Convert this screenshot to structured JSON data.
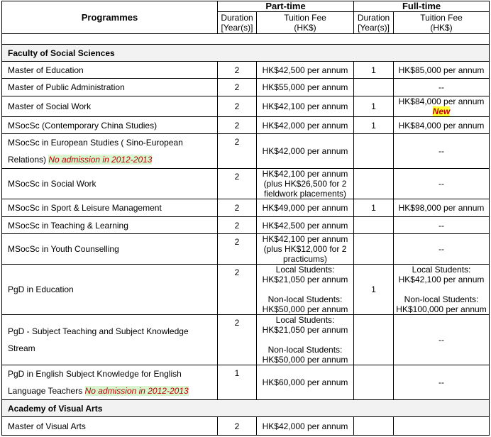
{
  "header": {
    "programmes": "Programmes",
    "part_time": "Part-time",
    "full_time": "Full-time",
    "duration_line1": "Duration",
    "duration_line2": "[Year(s)]",
    "fee_line1": "Tuition Fee",
    "fee_line2": "(HK$)"
  },
  "sections": [
    {
      "title": "Faculty of Social Sciences",
      "rows": [
        {
          "name": "Master of Education",
          "pt_dur": "2",
          "pt_fee": [
            "HK$42,500 per annum"
          ],
          "ft_dur": "1",
          "ft_fee": [
            "HK$85,000 per annum"
          ]
        },
        {
          "name": "Master of Public Administration",
          "pt_dur": "2",
          "pt_fee": [
            "HK$55,000 per annum"
          ],
          "ft_dur": "",
          "ft_fee": [
            "--"
          ]
        },
        {
          "name": "Master of Social Work",
          "pt_dur": "2",
          "pt_fee": [
            "HK$42,100 per annum"
          ],
          "ft_dur": "1",
          "ft_fee": [
            "HK$84,000 per annum"
          ],
          "ft_badge": "New"
        },
        {
          "name": "MSocSc (Contemporary China Studies)",
          "pt_dur": "2",
          "pt_fee": [
            "HK$42,000 per annum"
          ],
          "ft_dur": "1",
          "ft_fee": [
            "HK$84,000 per annum"
          ]
        },
        {
          "name": "MSocSc in European Studies ( Sino-European",
          "name2": "Relations)",
          "note": "No admission in 2012-2013",
          "pt_dur": "2",
          "pt_fee": [
            "HK$42,000 per annum"
          ],
          "ft_dur": "",
          "ft_fee": [
            "--"
          ]
        },
        {
          "name": "MSocSc in Social Work",
          "pt_dur": "2",
          "pt_fee": [
            "HK$42,100 per annum",
            "(plus HK$26,500 for 2",
            "fieldwork placements)"
          ],
          "ft_dur": "",
          "ft_fee": [
            "--"
          ]
        },
        {
          "name": "MSocSc in Sport & Leisure Management",
          "pt_dur": "2",
          "pt_fee": [
            "HK$49,000 per annum"
          ],
          "ft_dur": "1",
          "ft_fee": [
            "HK$98,000 per annum"
          ]
        },
        {
          "name": "MSocSc in Teaching & Learning",
          "pt_dur": "2",
          "pt_fee": [
            "HK$42,500 per annum"
          ],
          "ft_dur": "",
          "ft_fee": [
            "--"
          ]
        },
        {
          "name": "MSocSc in Youth Counselling",
          "pt_dur": "2",
          "pt_fee": [
            "HK$42,100 per annum",
            "(plus HK$12,000 for 2",
            "practicums)"
          ],
          "ft_dur": "",
          "ft_fee": [
            "--"
          ]
        },
        {
          "name": "PgD in Education",
          "pt_dur": "2",
          "pt_fee": [
            "Local Students:",
            "HK$21,050 per annum",
            "",
            "Non-local Students:",
            "HK$50,000 per annum"
          ],
          "ft_dur": "1",
          "ft_fee": [
            "Local Students:",
            "HK$42,100 per annum",
            "",
            "Non-local Students:",
            "HK$100,000 per annum"
          ]
        },
        {
          "name": "PgD - Subject Teaching and Subject Knowledge",
          "name2": "Stream",
          "pt_dur": "2",
          "pt_fee": [
            "Local Students:",
            "HK$21,050 per annum",
            "",
            "Non-local Students:",
            "HK$50,000 per annum"
          ],
          "ft_dur": "",
          "ft_fee": [
            "--"
          ]
        },
        {
          "name": "PgD in English Subject Knowledge for English",
          "name2": "Language Teachers",
          "note": "No admission in 2012-2013",
          "pt_dur": "1",
          "pt_fee": [
            "HK$60,000 per annum"
          ],
          "ft_dur": "",
          "ft_fee": [
            "--"
          ]
        }
      ]
    },
    {
      "title": "Academy of Visual Arts",
      "rows": [
        {
          "name": "Master of Visual Arts",
          "pt_dur": "2",
          "pt_fee": [
            "HK$42,000 per annum"
          ],
          "ft_dur": "",
          "ft_fee": [
            ""
          ]
        }
      ]
    }
  ]
}
